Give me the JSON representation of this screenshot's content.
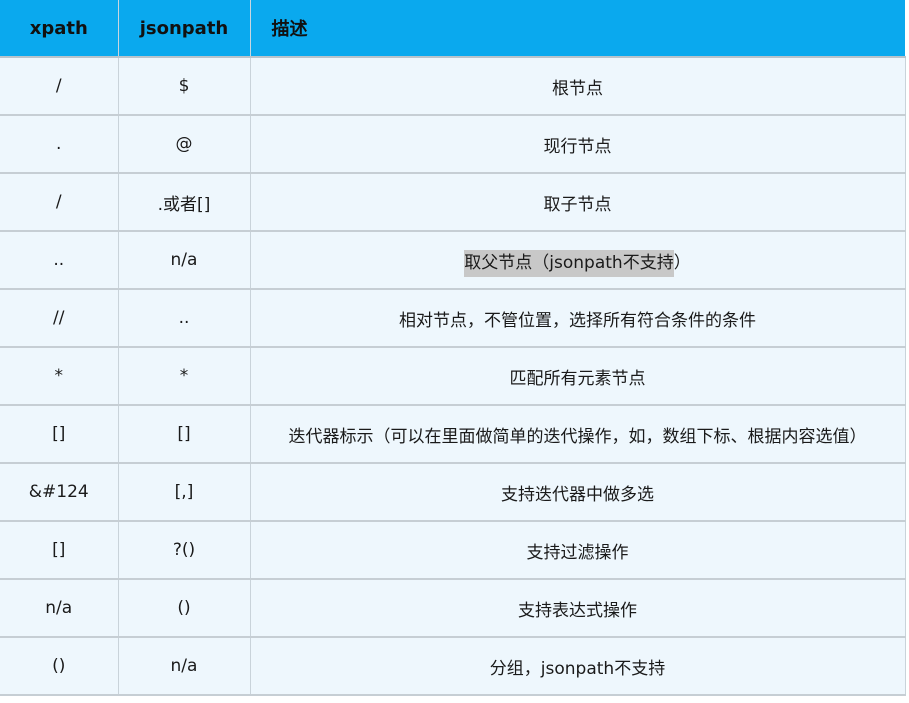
{
  "table": {
    "headers": [
      "xpath",
      "jsonpath",
      "描述"
    ],
    "rows": [
      {
        "xpath": "/",
        "jsonpath": "$",
        "desc": "根节点",
        "desc_highlight": "",
        "desc_rest": ""
      },
      {
        "xpath": ".",
        "jsonpath": "@",
        "desc": "现行节点",
        "desc_highlight": "",
        "desc_rest": ""
      },
      {
        "xpath": "/",
        "jsonpath": ".或者[]",
        "desc": "取子节点",
        "desc_highlight": "",
        "desc_rest": ""
      },
      {
        "xpath": "..",
        "jsonpath": "n/a",
        "desc": "",
        "desc_highlight": "取父节点（jsonpath不支持",
        "desc_rest": "）"
      },
      {
        "xpath": "//",
        "jsonpath": "..",
        "desc": "相对节点，不管位置，选择所有符合条件的条件",
        "desc_highlight": "",
        "desc_rest": ""
      },
      {
        "xpath": "*",
        "jsonpath": "*",
        "desc": "匹配所有元素节点",
        "desc_highlight": "",
        "desc_rest": ""
      },
      {
        "xpath": "[]",
        "jsonpath": "[]",
        "desc": "迭代器标示（可以在里面做简单的迭代操作，如，数组下标、根据内容选值）",
        "desc_highlight": "",
        "desc_rest": ""
      },
      {
        "xpath": "&#124",
        "jsonpath": "[,]",
        "desc": "支持迭代器中做多选",
        "desc_highlight": "",
        "desc_rest": ""
      },
      {
        "xpath": "[]",
        "jsonpath": "?()",
        "desc": "支持过滤操作",
        "desc_highlight": "",
        "desc_rest": ""
      },
      {
        "xpath": "n/a",
        "jsonpath": "()",
        "desc": "支持表达式操作",
        "desc_highlight": "",
        "desc_rest": ""
      },
      {
        "xpath": "()",
        "jsonpath": "n/a",
        "desc": "分组，jsonpath不支持",
        "desc_highlight": "",
        "desc_rest": ""
      }
    ]
  },
  "colors": {
    "header_bg": "#0aa9ee",
    "row_bg": "#eef7fd",
    "highlight_bg": "#c8c8c8"
  }
}
